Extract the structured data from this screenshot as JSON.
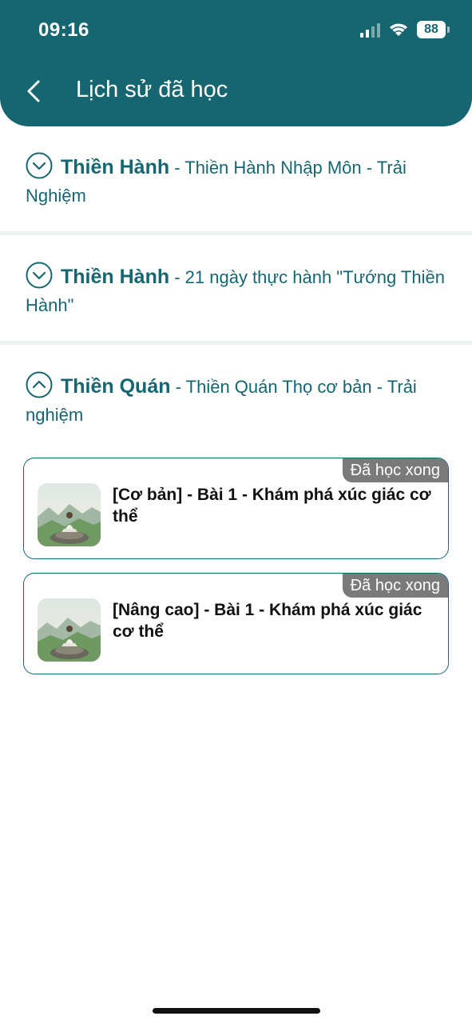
{
  "status_bar": {
    "time": "09:16",
    "battery": "88"
  },
  "header": {
    "title": "Lịch sử đã học"
  },
  "sections": [
    {
      "course": "Thiền Hành",
      "desc": " - Thiền Hành Nhập Môn - Trải Nghiệm",
      "expanded": false
    },
    {
      "course": "Thiền Hành",
      "desc": " - 21 ngày thực hành \"Tướng Thiền Hành\"",
      "expanded": false
    },
    {
      "course": "Thiền Quán",
      "desc": " - Thiền Quán Thọ cơ bản - Trải nghiệm",
      "expanded": true
    }
  ],
  "lessons": [
    {
      "title": "[Cơ bản] - Bài 1 - Khám phá xúc giác cơ thể",
      "status": "Đã học xong"
    },
    {
      "title": "[Nâng cao] - Bài 1 - Khám phá xúc giác cơ thể",
      "status": "Đã học xong"
    }
  ],
  "colors": {
    "primary": "#156670",
    "badge": "#7a7a7a",
    "divider": "#e8f0f0"
  }
}
